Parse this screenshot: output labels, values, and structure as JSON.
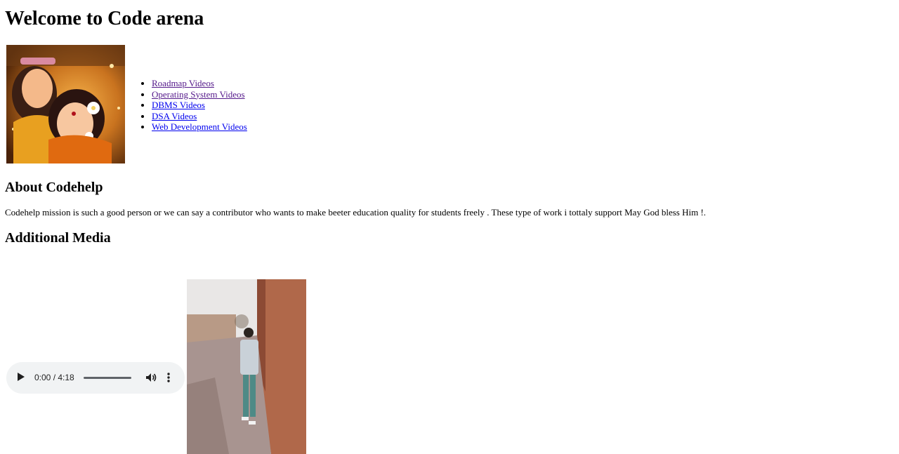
{
  "header": {
    "title": "Welcome to Code arena"
  },
  "nav": {
    "links": [
      {
        "label": "Roadmap Videos",
        "visited": true
      },
      {
        "label": "Operating System Videos",
        "visited": true
      },
      {
        "label": "DBMS Videos",
        "visited": false
      },
      {
        "label": "DSA Videos",
        "visited": false
      },
      {
        "label": "Web Development Videos",
        "visited": false
      }
    ]
  },
  "about": {
    "heading": "About Codehelp",
    "text": "Codehelp mission is such a good person or we can say a contributor who wants to make beeter education quality for students freely . These type of work i tottaly support May God bless Him !."
  },
  "media": {
    "heading": "Additional Media",
    "audio": {
      "time": "0:00 / 4:18",
      "progress": 0,
      "icons": [
        "play-icon",
        "volume-icon",
        "more-vert-icon"
      ]
    }
  },
  "colors": {
    "link": "#0000ee",
    "link_visited": "#551a8b",
    "player_bg": "#f1f3f4"
  }
}
